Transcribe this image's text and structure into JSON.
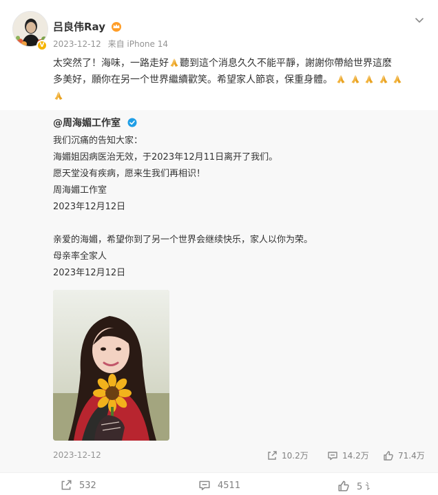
{
  "post": {
    "author": "吕良伟Ray",
    "date": "2023-12-12",
    "source": "来自 iPhone 14",
    "text_line1_a": "太突然了！海味，一路走好",
    "text_line1_b": "聽到這个消息久久不能平靜，謝謝你帶給世界這麽",
    "text_line2": "多美好，願你在另一个世界繼續歡笑。希望家人節哀，保重身體。"
  },
  "retweet": {
    "author": "@周海媚工作室",
    "lines": [
      "我们沉痛的告知大家：",
      "海媚姐因病医治无效，于2023年12月11日离开了我们。",
      "愿天堂没有疾病，愿来生我们再相识！",
      "周海媚工作室",
      "2023年12月12日",
      "",
      "亲爱的海媚，希望你到了另一个世界会继续快乐，家人以你为荣。",
      "母亲率全家人",
      "2023年12月12日"
    ],
    "date": "2023-12-12",
    "reposts": "10.2万",
    "comments": "14.2万",
    "likes": "71.4万"
  },
  "actions": {
    "reposts": "532",
    "comments": "4511",
    "likes": "5 讠"
  },
  "colors": {
    "badge": "#f5b400",
    "verify_blue": "#1f9ee6",
    "meta_gray": "#939393",
    "retweet_bg": "#f8f8f8"
  },
  "icons": [
    "crown-icon",
    "verified-badge-icon",
    "chevron-down-icon",
    "pray-emoji-icon",
    "repost-icon",
    "comment-icon",
    "like-icon"
  ]
}
